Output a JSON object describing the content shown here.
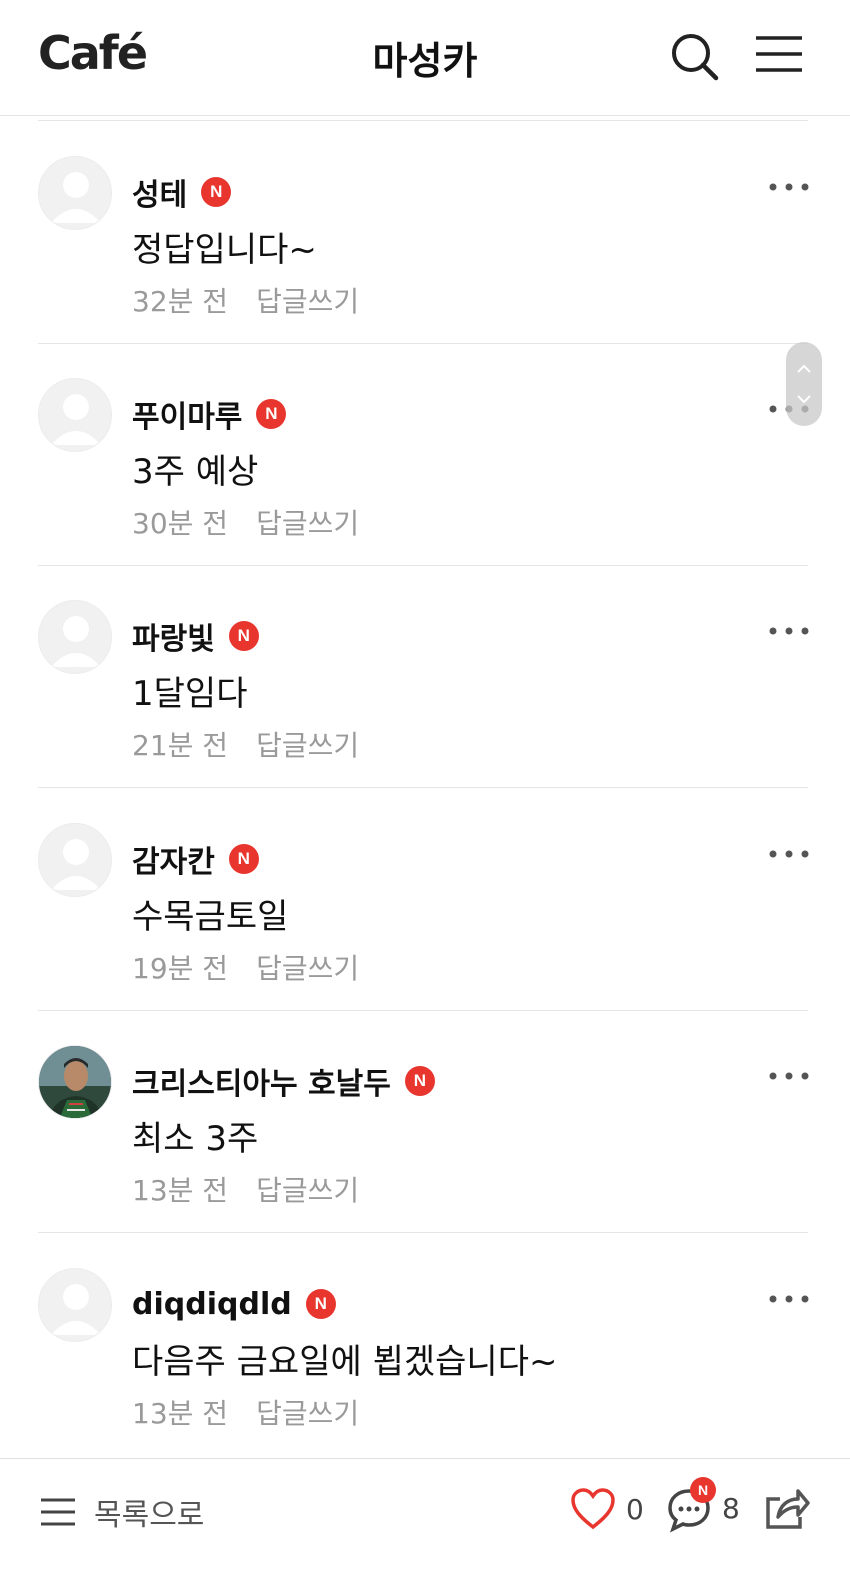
{
  "header": {
    "logo": "Café",
    "title": "마성카"
  },
  "comments": [
    {
      "author": "성테",
      "badge": "N",
      "text": "정답입니다~",
      "time": "32분 전",
      "reply": "답글쓰기",
      "avatar": "default"
    },
    {
      "author": "푸이마루",
      "badge": "N",
      "text": "3주 예상",
      "time": "30분 전",
      "reply": "답글쓰기",
      "avatar": "default"
    },
    {
      "author": "파랑빛",
      "badge": "N",
      "text": "1달임다",
      "time": "21분 전",
      "reply": "답글쓰기",
      "avatar": "default"
    },
    {
      "author": "감자칸",
      "badge": "N",
      "text": "수목금토일",
      "time": "19분 전",
      "reply": "답글쓰기",
      "avatar": "default"
    },
    {
      "author": "크리스티아누 호날두",
      "badge": "N",
      "text": "최소 3주",
      "time": "13분 전",
      "reply": "답글쓰기",
      "avatar": "photo"
    },
    {
      "author": "diqdiqdld",
      "badge": "N",
      "text": "다음주 금요일에 뵙겠습니다~",
      "time": "13분 전",
      "reply": "답글쓰기",
      "avatar": "default"
    }
  ],
  "bottom_bar": {
    "list_label": "목록으로",
    "like_count": "0",
    "comment_count": "8",
    "comment_badge": "N"
  },
  "colors": {
    "badge": "#e8362f",
    "like": "#e8362f",
    "meta_text": "#9a9a9a"
  },
  "icons": [
    "search-icon",
    "menu-icon",
    "more-icon",
    "heart-icon",
    "comment-icon",
    "share-icon",
    "list-icon"
  ]
}
